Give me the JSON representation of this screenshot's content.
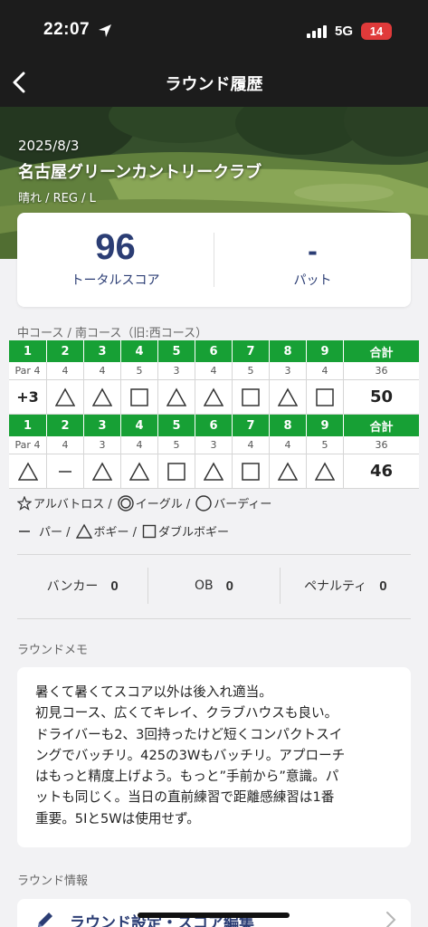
{
  "status_bar": {
    "time": "22:07",
    "network": "5G",
    "battery": "14"
  },
  "nav": {
    "title": "ラウンド履歴"
  },
  "round": {
    "date": "2025/8/3",
    "course_name": "名古屋グリーンカントリークラブ",
    "conditions": "晴れ / REG  / L"
  },
  "summary": {
    "total_score": "96",
    "total_label": "トータルスコア",
    "putts": "-",
    "putts_label": "パット"
  },
  "course_label": "中コース / 南コース（旧:西コース）",
  "scorecard": [
    {
      "holes": [
        "1",
        "2",
        "3",
        "4",
        "5",
        "6",
        "7",
        "8",
        "9"
      ],
      "total_header": "合計",
      "pars": [
        "Par 4",
        "4",
        "4",
        "5",
        "3",
        "4",
        "5",
        "3",
        "4"
      ],
      "par_total": "36",
      "first_cell": "+3",
      "marks": [
        "bogey",
        "bogey",
        "double",
        "bogey",
        "bogey",
        "double",
        "bogey",
        "double"
      ],
      "score_total": "50"
    },
    {
      "holes": [
        "1",
        "2",
        "3",
        "4",
        "5",
        "6",
        "7",
        "8",
        "9"
      ],
      "total_header": "合計",
      "pars": [
        "Par 4",
        "4",
        "3",
        "4",
        "5",
        "3",
        "4",
        "4",
        "5"
      ],
      "par_total": "36",
      "first_cell": "",
      "marks": [
        "bogey",
        "par",
        "bogey",
        "bogey",
        "double",
        "bogey",
        "double",
        "bogey",
        "bogey"
      ],
      "score_total": "46"
    }
  ],
  "legend": {
    "albatross": "アルバトロス /",
    "eagle": "イーグル /",
    "birdie": "バーディー",
    "par": "パー /",
    "bogey": "ボギー /",
    "double": "ダブルボギー"
  },
  "stats": {
    "bunker_label": "バンカー",
    "bunker": "0",
    "ob_label": "OB",
    "ob": "0",
    "penalty_label": "ペナルティ",
    "penalty": "0"
  },
  "memo": {
    "label": "ラウンドメモ",
    "text": "暑くて暑くてスコア以外は後入れ適当。\n初見コース、広くてキレイ、クラブハウスも良い。\nドライバーも2、3回持ったけど短くコンパクトスイ\nングでバッチリ。425の3Wもバッチリ。アプローチ\nはもっと精度上げよう。もっと”手前から”意識。パ\nットも同じく。当日の直前練習で距離感練習は1番\n重要。5Iと5Wは使用せず。"
  },
  "round_info": {
    "label": "ラウンド情報",
    "edit_label": "ラウンド設定・スコア編集"
  },
  "colors": {
    "header_green": "#17a035",
    "navy": "#2b3d74",
    "dark_bar": "#1c1c1c"
  }
}
